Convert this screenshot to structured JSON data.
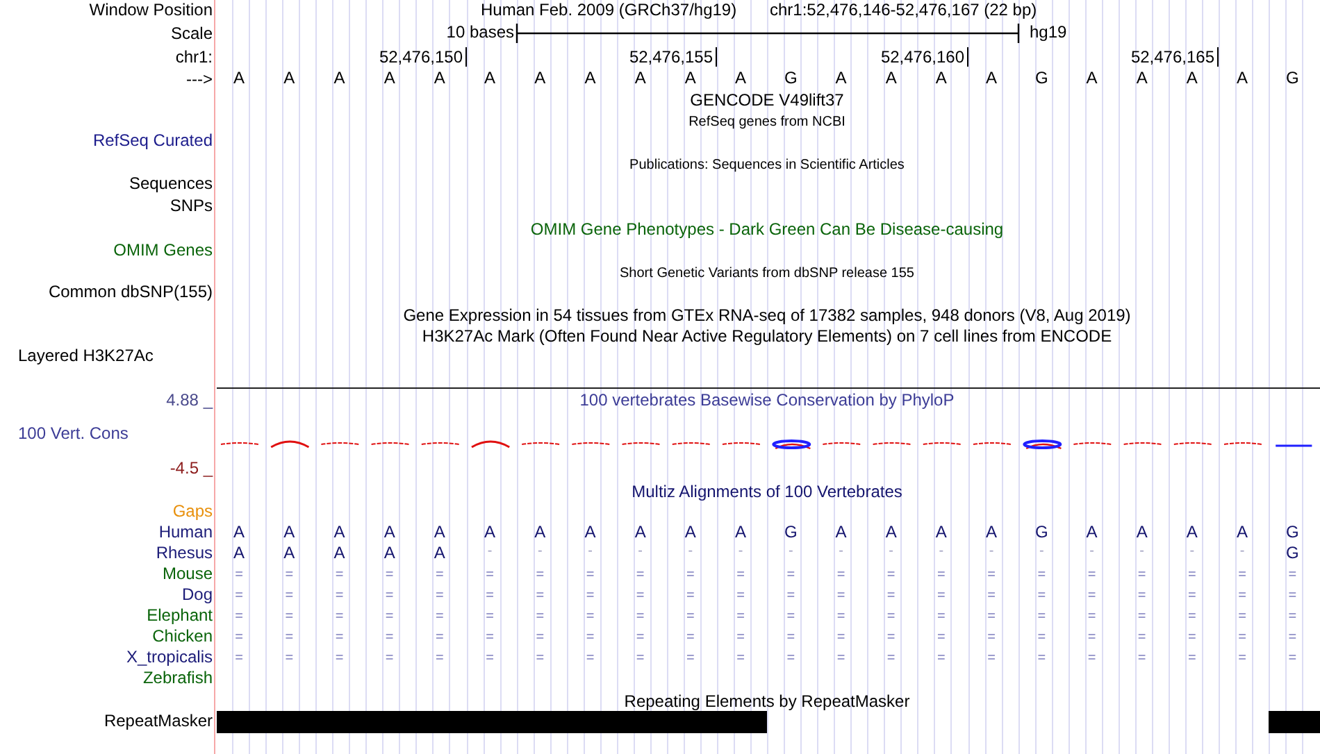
{
  "header": {
    "label": "Window Position",
    "assembly": "Human Feb. 2009 (GRCh37/hg19)",
    "position": "chr1:52,476,146-52,476,167 (22 bp)"
  },
  "scale": {
    "label": "Scale",
    "length": "10 bases",
    "assembly": "hg19"
  },
  "ruler": {
    "label": "chr1:",
    "ticks": [
      "52,476,150",
      "52,476,155",
      "52,476,160",
      "52,476,165"
    ]
  },
  "sequence": {
    "label": "--->",
    "bases": [
      "A",
      "A",
      "A",
      "A",
      "A",
      "A",
      "A",
      "A",
      "A",
      "A",
      "A",
      "G",
      "A",
      "A",
      "A",
      "A",
      "G",
      "A",
      "A",
      "A",
      "A",
      "G"
    ]
  },
  "tracks": [
    {
      "kind": "title",
      "text": "GENCODE V49lift37",
      "color": "#000000"
    },
    {
      "kind": "subtitle",
      "text": "RefSeq genes from NCBI",
      "color": "#000000"
    },
    {
      "kind": "label",
      "text": "RefSeq Curated",
      "color": "#1c1c8c"
    },
    {
      "kind": "subtitle",
      "text": "Publications: Sequences in Scientific Articles",
      "color": "#000000"
    },
    {
      "kind": "label",
      "text": "Sequences",
      "color": "#000000"
    },
    {
      "kind": "label",
      "text": "SNPs",
      "color": "#000000"
    },
    {
      "kind": "title",
      "text": "OMIM Gene Phenotypes - Dark Green Can Be Disease-causing",
      "color": "#0a640a"
    },
    {
      "kind": "label",
      "text": "OMIM Genes",
      "color": "#0a640a"
    },
    {
      "kind": "subtitle",
      "text": "Short Genetic Variants from dbSNP release 155",
      "color": "#000000"
    },
    {
      "kind": "label",
      "text": "Common dbSNP(155)",
      "color": "#000000"
    },
    {
      "kind": "title",
      "text": "Gene Expression in 54 tissues from GTEx RNA-seq of 17382 samples, 948 donors (V8, Aug 2019)",
      "color": "#000000"
    },
    {
      "kind": "title",
      "text": "H3K27Ac Mark (Often Found Near Active Regulatory Elements) on 7 cell lines from ENCODE",
      "color": "#000000"
    },
    {
      "kind": "label-left",
      "text": "Layered H3K27Ac",
      "color": "#000000"
    }
  ],
  "conservation": {
    "title": "100 vertebrates Basewise Conservation by PhyloP",
    "label": "100 Vert. Cons",
    "max": "4.88 _",
    "min": "-4.5 _"
  },
  "multiz": {
    "title": "Multiz Alignments of 100 Vertebrates",
    "gaps_label": "Gaps",
    "species": [
      {
        "name": "Human",
        "color": "#1c1c78",
        "bases": [
          "A",
          "A",
          "A",
          "A",
          "A",
          "A",
          "A",
          "A",
          "A",
          "A",
          "A",
          "G",
          "A",
          "A",
          "A",
          "A",
          "G",
          "A",
          "A",
          "A",
          "A",
          "G"
        ]
      },
      {
        "name": "Rhesus",
        "color": "#1c1c78",
        "bases": [
          "A",
          "A",
          "A",
          "A",
          "A",
          "-",
          "-",
          "-",
          "-",
          "-",
          "-",
          "-",
          "-",
          "-",
          "-",
          "-",
          "-",
          "-",
          "-",
          "-",
          "-",
          "G"
        ]
      },
      {
        "name": "Mouse",
        "color": "#0a640a",
        "bases": [
          "=",
          "=",
          "=",
          "=",
          "=",
          "=",
          "=",
          "=",
          "=",
          "=",
          "=",
          "=",
          "=",
          "=",
          "=",
          "=",
          "=",
          "=",
          "=",
          "=",
          "=",
          "="
        ]
      },
      {
        "name": "Dog",
        "color": "#1c1c78",
        "bases": [
          "=",
          "=",
          "=",
          "=",
          "=",
          "=",
          "=",
          "=",
          "=",
          "=",
          "=",
          "=",
          "=",
          "=",
          "=",
          "=",
          "=",
          "=",
          "=",
          "=",
          "=",
          "="
        ]
      },
      {
        "name": "Elephant",
        "color": "#0a640a",
        "bases": [
          "=",
          "=",
          "=",
          "=",
          "=",
          "=",
          "=",
          "=",
          "=",
          "=",
          "=",
          "=",
          "=",
          "=",
          "=",
          "=",
          "=",
          "=",
          "=",
          "=",
          "=",
          "="
        ]
      },
      {
        "name": "Chicken",
        "color": "#0a640a",
        "bases": [
          "=",
          "=",
          "=",
          "=",
          "=",
          "=",
          "=",
          "=",
          "=",
          "=",
          "=",
          "=",
          "=",
          "=",
          "=",
          "=",
          "=",
          "=",
          "=",
          "=",
          "=",
          "="
        ]
      },
      {
        "name": "X_tropicalis",
        "color": "#1c1c78",
        "bases": [
          "=",
          "=",
          "=",
          "=",
          "=",
          "=",
          "=",
          "=",
          "=",
          "=",
          "=",
          "=",
          "=",
          "=",
          "=",
          "=",
          "=",
          "=",
          "=",
          "=",
          "=",
          "="
        ]
      },
      {
        "name": "Zebrafish",
        "color": "#0a640a"
      }
    ]
  },
  "repeatmasker": {
    "title": "Repeating Elements by RepeatMasker",
    "label": "RepeatMasker"
  }
}
